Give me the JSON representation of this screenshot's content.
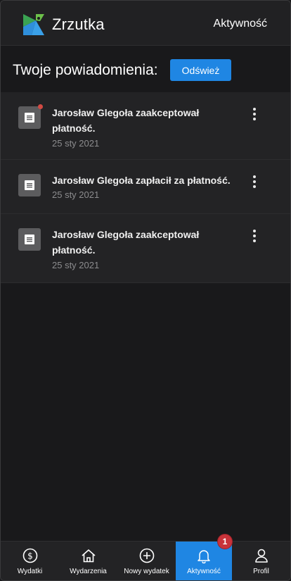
{
  "header": {
    "app_title": "Zrzutka",
    "activity_link": "Aktywność"
  },
  "main": {
    "heading": "Twoje powiadomienia:",
    "refresh_label": "Odśwież"
  },
  "notifications": [
    {
      "text": "Jarosław Glegoła zaakceptował płatność.",
      "date": "25 sty 2021",
      "unread": true
    },
    {
      "text": "Jarosław Glegoła zapłacił za płatność.",
      "date": "25 sty 2021",
      "unread": false
    },
    {
      "text": "Jarosław Glegoła zaakceptował płatność.",
      "date": "25 sty 2021",
      "unread": false
    }
  ],
  "bottom_nav": {
    "items": [
      {
        "label": "Wydatki",
        "icon": "dollar-circle-icon"
      },
      {
        "label": "Wydarzenia",
        "icon": "home-icon"
      },
      {
        "label": "Nowy wydatek",
        "icon": "plus-circle-icon"
      },
      {
        "label": "Aktywność",
        "icon": "bell-icon",
        "active": true,
        "badge": "1"
      },
      {
        "label": "Profil",
        "icon": "user-icon"
      }
    ]
  },
  "colors": {
    "accent": "#1f86e3",
    "badge": "#c8333a",
    "background": "#19191b",
    "card": "#232325"
  }
}
